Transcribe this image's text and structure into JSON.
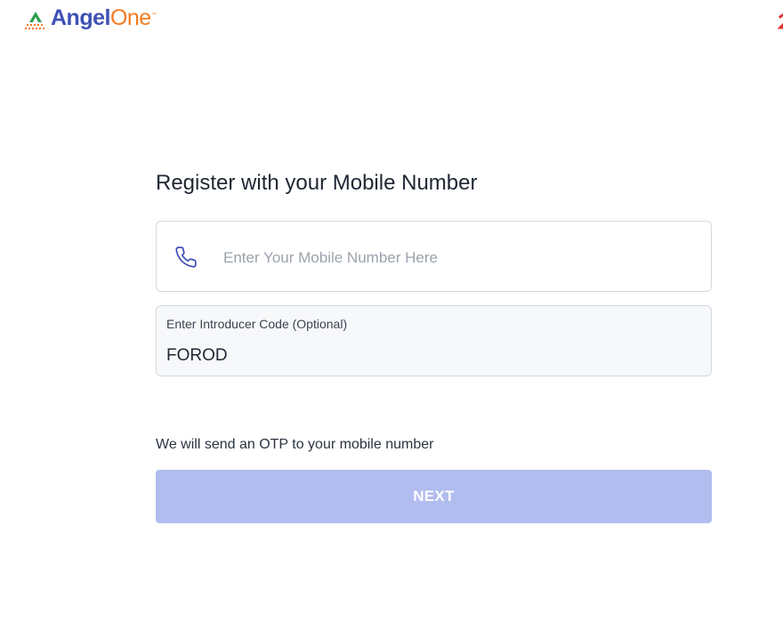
{
  "header": {
    "logo_primary": "Angel",
    "logo_secondary": "One",
    "logo_tm": "™",
    "logo_icon": "angelone-pyramid-logo",
    "brand_colors": {
      "angel": "#3f51b5",
      "one": "#f47b20",
      "pyramid_green": "#2e9e4f",
      "pyramid_orange": "#f47b20"
    }
  },
  "form": {
    "title": "Register with your Mobile Number",
    "phone": {
      "icon": "phone-icon",
      "placeholder": "Enter Your Mobile Number Here",
      "value": ""
    },
    "introducer": {
      "label": "Enter Introducer Code (Optional)",
      "value": "FOROD"
    },
    "otp_note": "We will send an OTP to your mobile number",
    "next_label": "NEXT",
    "next_color": "#b1bcef"
  }
}
